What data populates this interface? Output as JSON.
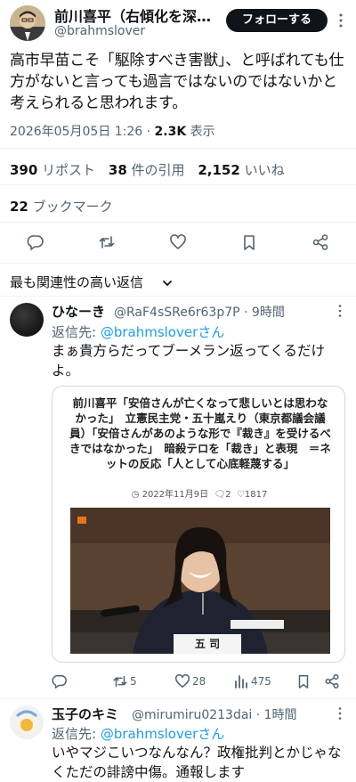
{
  "author": {
    "name": "前川喜平（右傾化を深…",
    "handle": "@brahmslover",
    "follow_label": "フォローする"
  },
  "tweet": {
    "text": "高市早苗こそ「駆除すべき害獣」、と呼ばれても仕方がないと言っても過言ではないのではないかと考えられると思われます。",
    "timestamp": "2026年05月05日 1:26",
    "separator": "·",
    "views_count": "2.3K",
    "views_label": "表示",
    "reposts_count": "390",
    "reposts_label": "リポスト",
    "quotes_count": "38",
    "quotes_label": "件の引用",
    "likes_count": "2,152",
    "likes_label": "いいね",
    "bookmarks_count": "22",
    "bookmarks_label": "ブックマーク"
  },
  "sort": {
    "label": "最も関連性の高い返信"
  },
  "replies": [
    {
      "name": "ひなーき",
      "handle_time": "@RaF4sSRe6r63p7P · 9時間",
      "reply_to_label": "返信先: ",
      "reply_to_link": "@brahmslover",
      "reply_to_suffix": "さん",
      "text": "まぁ貴方らだってブーメラン返ってくるだけよ。",
      "card": {
        "title": "前川喜平「安倍さんが亡くなって悲しいとは思わなかった」　立憲民主党・五十嵐えり（東京都議会議員）「安倍さんがあのような形で『裁き』を受けるべきではなかった」　暗殺テロを「裁き」と表現　＝ネットの反応「人として心底軽蔑する」",
        "date": "2022年11月9日",
        "comments": "2",
        "likes": "1817",
        "nameplate": "五 司"
      },
      "retweets": "5",
      "likes": "28",
      "views": "475"
    },
    {
      "name": "玉子のキミ",
      "handle_time": "@mirumiru0213dai · 1時間",
      "reply_to_label": "返信先: ",
      "reply_to_link": "@brahmslover",
      "reply_to_suffix": "さん",
      "text": "いやマジこいつなんなん？政権批判とかじゃなくただの誹謗中傷。通報します"
    }
  ],
  "colors": {
    "text": "#0f1419",
    "secondary": "#536471",
    "link": "#1d9bf0",
    "divider": "#eff3f4",
    "button_bg": "#0f1419"
  },
  "icons": [
    "more-icon",
    "reply-icon",
    "retweet-icon",
    "like-icon",
    "bookmark-icon",
    "share-icon",
    "chevron-down-icon",
    "clock-icon",
    "comment-icon",
    "heart-icon",
    "views-icon"
  ]
}
